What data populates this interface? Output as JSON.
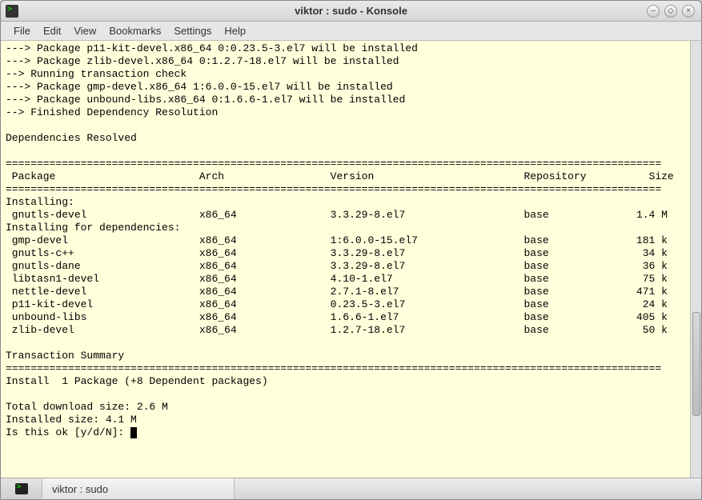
{
  "window": {
    "title": "viktor : sudo - Konsole"
  },
  "menubar": {
    "file": "File",
    "edit": "Edit",
    "view": "View",
    "bookmarks": "Bookmarks",
    "settings": "Settings",
    "help": "Help"
  },
  "terminal": {
    "lines_top1": "---> Package p11-kit-devel.x86_64 0:0.23.5-3.el7 will be installed",
    "lines_top2": "---> Package zlib-devel.x86_64 0:1.2.7-18.el7 will be installed",
    "lines_top3": "--> Running transaction check",
    "lines_top4": "---> Package gmp-devel.x86_64 1:6.0.0-15.el7 will be installed",
    "lines_top5": "---> Package unbound-libs.x86_64 0:1.6.6-1.el7 will be installed",
    "lines_top6": "--> Finished Dependency Resolution",
    "deps_resolved": "Dependencies Resolved",
    "rule_dbl": "=========================================================================================================",
    "header_row": " Package                       Arch                 Version                        Repository          Size",
    "installing_hdr": "Installing:",
    "row_gnutls_devel": " gnutls-devel                  x86_64               3.3.29-8.el7                   base              1.4 M",
    "installing_deps_hdr": "Installing for dependencies:",
    "row_gmp_devel": " gmp-devel                     x86_64               1:6.0.0-15.el7                 base              181 k",
    "row_gnutls_cpp": " gnutls-c++                    x86_64               3.3.29-8.el7                   base               34 k",
    "row_gnutls_dane": " gnutls-dane                   x86_64               3.3.29-8.el7                   base               36 k",
    "row_libtasn1": " libtasn1-devel                x86_64               4.10-1.el7                     base               75 k",
    "row_nettle": " nettle-devel                  x86_64               2.7.1-8.el7                    base              471 k",
    "row_p11kit": " p11-kit-devel                 x86_64               0.23.5-3.el7                   base               24 k",
    "row_unbound": " unbound-libs                  x86_64               1.6.6-1.el7                    base              405 k",
    "row_zlib": " zlib-devel                    x86_64               1.2.7-18.el7                   base               50 k",
    "trans_summary": "Transaction Summary",
    "install_summary": "Install  1 Package (+8 Dependent packages)",
    "total_download": "Total download size: 2.6 M",
    "installed_size": "Installed size: 4.1 M",
    "prompt": "Is this ok [y/d/N]: "
  },
  "taskbar": {
    "active_tab": "viktor : sudo"
  }
}
